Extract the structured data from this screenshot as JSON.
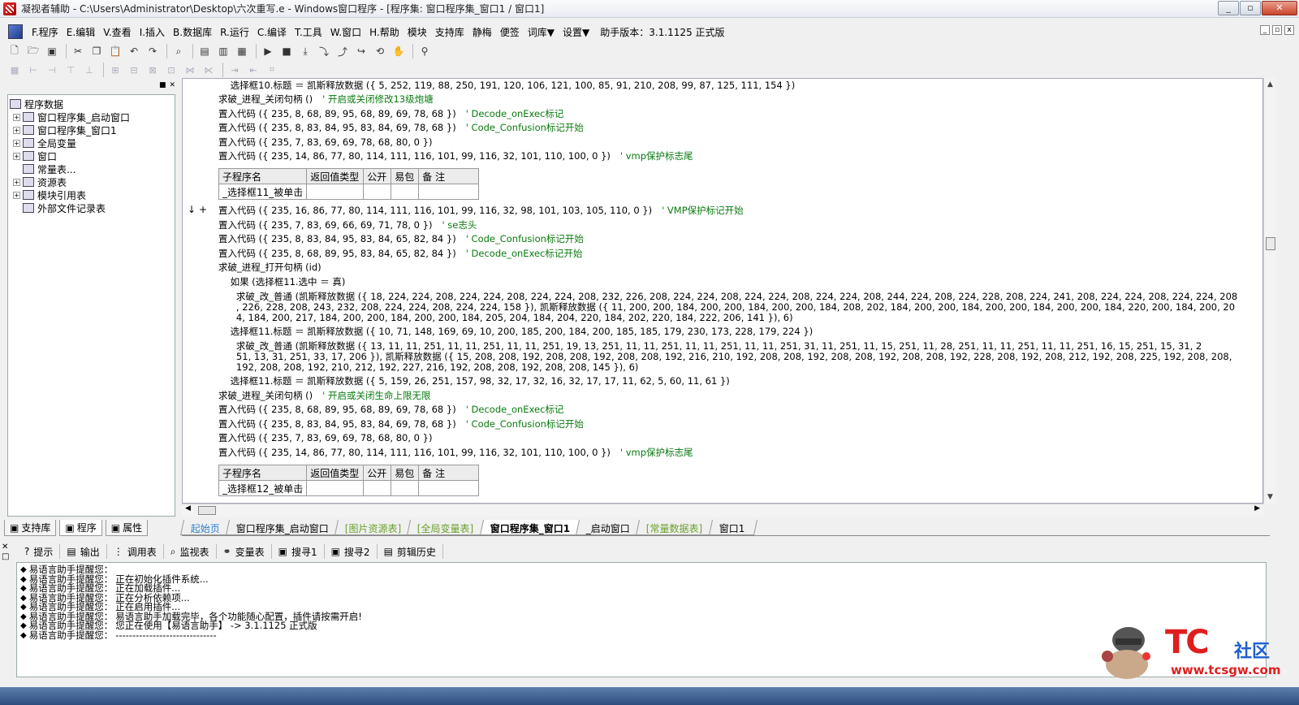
{
  "window": {
    "title": "凝视者辅助 - C:\\Users\\Administrator\\Desktop\\六次重写.e - Windows窗口程序 - [程序集: 窗口程序集_窗口1 / 窗口1]",
    "minimize": "_",
    "maximize": "▫",
    "close": "✕"
  },
  "menu": {
    "items": [
      "F.程序",
      "E.编辑",
      "V.查看",
      "I.插入",
      "B.数据库",
      "R.运行",
      "C.编译",
      "T.工具",
      "W.窗口",
      "H.帮助",
      "模块",
      "支持库",
      "静梅",
      "便签",
      "词库▼",
      "设置▼"
    ],
    "version": "助手版本：3.1.1125 正式版"
  },
  "left_panel": {
    "tree": [
      {
        "label": "程序数据",
        "expander": "",
        "level": 0
      },
      {
        "label": "窗口程序集_启动窗口",
        "expander": "+",
        "level": 1
      },
      {
        "label": "窗口程序集_窗口1",
        "expander": "+",
        "level": 1
      },
      {
        "label": "全局变量",
        "expander": "+",
        "level": 1
      },
      {
        "label": "窗口",
        "expander": "+",
        "level": 1
      },
      {
        "label": "常量表...",
        "expander": "",
        "level": 1
      },
      {
        "label": "资源表",
        "expander": "+",
        "level": 1
      },
      {
        "label": "模块引用表",
        "expander": "+",
        "level": 1
      },
      {
        "label": "外部文件记录表",
        "expander": "",
        "level": 1
      }
    ],
    "tabs": [
      "支持库",
      "程序",
      "属性"
    ]
  },
  "editor": {
    "lines": [
      {
        "t": "    选择框10.标题 ＝ 凯斯释放数据 ({ 5, 252, 119, 88, 250, 191, 120, 106, 121, 100, 85, 91, 210, 208, 99, 87, 125, 111, 154 })",
        "c": ""
      },
      {
        "t": "求破_进程_关闭句柄 ()",
        "c": "' 开启或关闭修改13级炮塘"
      },
      {
        "t": "置入代码 ({ 235, 8, 68, 89, 95, 68, 89, 69, 78, 68 })",
        "c": "' Decode_onExec标记"
      },
      {
        "t": "置入代码 ({ 235, 8, 83, 84, 95, 83, 84, 69, 78, 68 })",
        "c": "' Code_Confusion标记开始"
      },
      {
        "t": "置入代码 ({ 235, 7, 83, 69, 69, 78, 68, 80, 0 })",
        "c": ""
      },
      {
        "t": "置入代码 ({ 235, 14, 86, 77, 80, 114, 111, 116, 101, 99, 116, 32, 101, 110, 100, 0 })",
        "c": "' vmp保护标志尾"
      },
      {
        "t": "置入代码 ({ 235, 16, 86, 77, 80, 114, 111, 116, 101, 99, 116, 32, 98, 101, 103, 105, 110, 0 })",
        "c": "' VMP保护标记开始"
      },
      {
        "t": "置入代码 ({ 235, 7, 83, 69, 66, 69, 71, 78, 0 })",
        "c": "' se志头"
      },
      {
        "t": "置入代码 ({ 235, 8, 83, 84, 95, 83, 84, 65, 82, 84 })",
        "c": "' Code_Confusion标记开始"
      },
      {
        "t": "置入代码 ({ 235, 8, 68, 89, 95, 83, 84, 65, 82, 84 })",
        "c": "' Decode_onExec标记开始"
      },
      {
        "t": "求破_进程_打开句柄 (id)",
        "c": ""
      },
      {
        "t": "    如果 (选择框11.选中 ＝ 真)",
        "c": ""
      },
      {
        "t": "      求破_改_普通 (凯斯释放数据 ({ 18, 224, 224, 208, 224, 224, 208, 224, 224, 208, 232, 226, 208, 224, 224, 208, 224, 224, 208, 224, 224, 208, 244, 224, 208, 224, 228, 208, 224, 241, 208, 224, 224, 208, 224, 224, 208",
        "c": ""
      },
      {
        "t": "      , 226, 228, 208, 243, 232, 208, 224, 224, 208, 224, 224, 158 }), 凯斯释放数据 ({ 11, 200, 200, 184, 200, 200, 184, 200, 200, 184, 208, 202, 184, 200, 200, 184, 200, 200, 184, 200, 200, 184, 220, 200, 184, 200, 20",
        "c": ""
      },
      {
        "t": "      4, 184, 200, 217, 184, 200, 200, 184, 200, 200, 184, 205, 204, 184, 204, 220, 184, 202, 220, 184, 222, 206, 141 }), 6)",
        "c": ""
      },
      {
        "t": "    选择框11.标题 ＝ 凯斯释放数据 ({ 10, 71, 148, 169, 69, 10, 200, 185, 200, 184, 200, 185, 185, 179, 230, 173, 228, 179, 224 })",
        "c": ""
      },
      {
        "t": "      求破_改_普通 (凯斯释放数据 ({ 13, 11, 11, 251, 11, 11, 251, 11, 11, 251, 19, 13, 251, 11, 11, 251, 11, 11, 251, 11, 11, 251, 31, 11, 251, 11, 15, 251, 11, 28, 251, 11, 11, 251, 11, 11, 251, 16, 15, 251, 15, 31, 2",
        "c": ""
      },
      {
        "t": "      51, 13, 31, 251, 33, 17, 206 }), 凯斯释放数据 ({ 15, 208, 208, 192, 208, 208, 192, 208, 208, 192, 216, 210, 192, 208, 208, 192, 208, 208, 192, 208, 208, 192, 228, 208, 192, 208, 212, 192, 208, 225, 192, 208, 208,",
        "c": ""
      },
      {
        "t": "      192, 208, 208, 192, 210, 212, 192, 227, 216, 192, 208, 208, 192, 208, 208, 145 }), 6)",
        "c": ""
      },
      {
        "t": "    选择框11.标题 ＝ 凯斯释放数据 ({ 5, 159, 26, 251, 157, 98, 32, 17, 32, 16, 32, 17, 17, 11, 62, 5, 60, 11, 61 })",
        "c": ""
      },
      {
        "t": "求破_进程_关闭句柄 ()",
        "c": "' 开启或关闭生命上限无限"
      },
      {
        "t": "置入代码 ({ 235, 8, 68, 89, 95, 68, 89, 69, 78, 68 })",
        "c": "' Decode_onExec标记"
      },
      {
        "t": "置入代码 ({ 235, 8, 83, 84, 95, 83, 84, 69, 78, 68 })",
        "c": "' Code_Confusion标记开始"
      },
      {
        "t": "置入代码 ({ 235, 7, 83, 69, 69, 78, 68, 80, 0 })",
        "c": ""
      },
      {
        "t": "置入代码 ({ 235, 14, 86, 77, 80, 114, 111, 116, 101, 99, 116, 32, 101, 110, 100, 0 })",
        "c": "' vmp保护标志尾"
      }
    ],
    "sub_headers": [
      "子程序名",
      "返回值类型",
      "公开",
      "易包",
      "备 注"
    ],
    "subs": [
      "_选择框11_被单击",
      "_选择框12_被单击"
    ]
  },
  "doc_tabs": [
    "起始页",
    "窗口程序集_启动窗口",
    "[图片资源表]",
    "[全局变量表]",
    "窗口程序集_窗口1",
    "_启动窗口",
    "[常量数据表]",
    "窗口1"
  ],
  "output_tabs": [
    "提示",
    "输出",
    "调用表",
    "监视表",
    "变量表",
    "搜寻1",
    "搜寻2",
    "剪辑历史"
  ],
  "output": {
    "prefix": "易语言助手提醒您：",
    "lines": [
      "",
      "正在初始化插件系统...",
      "正在加载插件...",
      "正在分析依赖项...",
      "正在启用插件...",
      "易语言助手加载完毕，各个功能随心配置，插件请按需开启!",
      "您正在使用【易语言助手】 -> 3.1.1125 正式版",
      "------------------------------"
    ]
  },
  "watermark": {
    "brand": "TC",
    "community": "社区",
    "url": "www.tcsgw.com"
  }
}
